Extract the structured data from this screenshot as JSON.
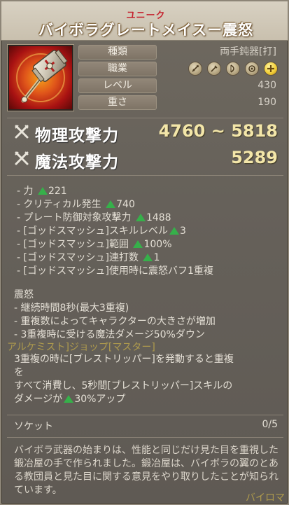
{
  "item": {
    "rarity": "ユニーク",
    "name": "バイボラグレートメイスー震怒"
  },
  "info": {
    "type_label": "種類",
    "type_value": "両手鈍器[打]",
    "class_label": "職業",
    "class_icons": [
      "swordsman-class-icon",
      "scout-class-icon",
      "archer-class-icon",
      "wizard-class-icon",
      "cleric-class-icon"
    ],
    "level_label": "レベル",
    "level_value": "430",
    "weight_label": "重さ",
    "weight_value": "190"
  },
  "attack": {
    "physical_label": "物理攻撃力",
    "physical_value": "4760 ~ 5818",
    "magic_label": "魔法攻撃力",
    "magic_value": "5289"
  },
  "effects": [
    {
      "text": "- 力 ",
      "arrow": true,
      "value": "221"
    },
    {
      "text": "- クリティカル発生 ",
      "arrow": true,
      "value": "740"
    },
    {
      "text": "- プレート防御対象攻撃力 ",
      "arrow": true,
      "value": "1488"
    },
    {
      "text": "-  [ゴッドスマッシュ]スキルレベル",
      "arrow": true,
      "value": "3"
    },
    {
      "text": "-  [ゴッドスマッシュ]範囲 ",
      "arrow": true,
      "value": "100%"
    },
    {
      "text": "- [ゴッドスマッシュ]連打数 ",
      "arrow": true,
      "value": "1"
    },
    {
      "text": "- [ゴッドスマッシュ]使用時に震怒バフ1重複",
      "arrow": false,
      "value": ""
    }
  ],
  "special": {
    "title": "震怒",
    "lines": [
      "- 継続時間8秒(最大3重複)",
      "- 重複数によってキャラクターの大きさが増加",
      "- 3重複時に受ける魔法ダメージ50%ダウン"
    ],
    "line4": "3重複の時に[ブレストリッパー]を発動すると重複",
    "line5": "を",
    "line6": "すべて消費し、5秒間[ブレストリッパー]スキルの",
    "line7_prefix": "ダメージが",
    "line7_value": "30%アップ"
  },
  "set_overlay_text": "アルケミスト]ジョップ[マスター]",
  "socket": {
    "label": "ソケット",
    "value": "0/5"
  },
  "description": "バイボラ武器の始まりは、性能と同じだけ見た目を重視した鍛冶屋の手で作られました。鍛冶屋は、バイボラの翼のとある教団員と見た目に関する意見をやり取りしたことが知られています。",
  "corner_overlay_text": "バイロマ",
  "colors": {
    "rarity": "#c5232f",
    "attack_value": "#f3e6a9",
    "up_arrow": "#36b04a"
  }
}
